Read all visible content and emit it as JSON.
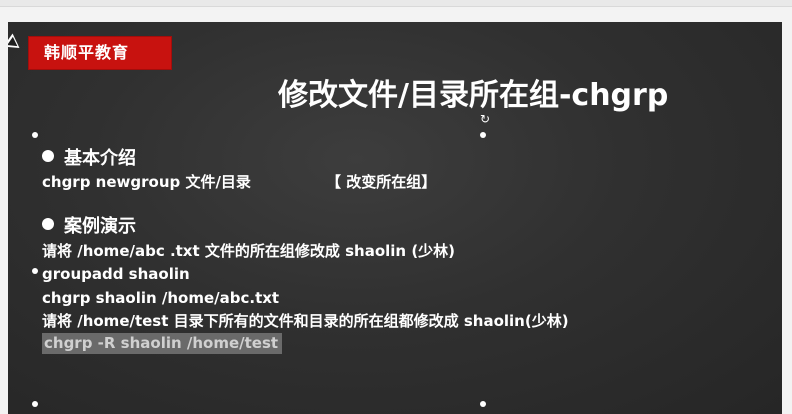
{
  "slide": {
    "brand": "韩顺平教育",
    "title": "修改文件/目录所在组-chgrp",
    "sections": [
      {
        "heading": "基本介绍",
        "lines": [
          {
            "text": "chgrp newgroup 文件/目录",
            "aside": "【 改变所在组】"
          }
        ]
      },
      {
        "heading": "案例演示",
        "lines": [
          {
            "text": "请将 /home/abc .txt 文件的所在组修改成 shaolin (少林)"
          },
          {
            "text": "groupadd shaolin"
          },
          {
            "text": "chgrp shaolin /home/abc.txt"
          },
          {
            "text": "请将 /home/test 目录下所有的文件和目录的所在组都修改成 shaolin(少林)"
          },
          {
            "text": "chgrp -R shaolin /home/test",
            "highlighted": true
          }
        ]
      }
    ]
  },
  "colors": {
    "slide_bg": "#2d2d2d",
    "brand_bg": "#c8120f",
    "text": "#ffffff",
    "highlight": "#6a6a6a"
  },
  "icons": [
    "cursor-arrow-icon",
    "rotate-handle-icon",
    "selection-handle-icon"
  ]
}
